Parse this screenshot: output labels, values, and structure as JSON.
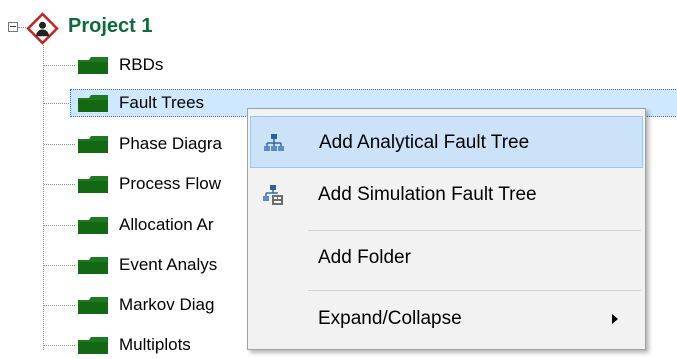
{
  "tree": {
    "project": {
      "label": "Project 1",
      "expander_state": "expanded",
      "icon": "project-diamond-icon"
    },
    "items": [
      {
        "label": "RBDs",
        "icon": "folder-icon"
      },
      {
        "label": "Fault Trees",
        "icon": "folder-icon",
        "selected": true
      },
      {
        "label": "Phase Diagra",
        "icon": "folder-icon"
      },
      {
        "label": "Process Flow",
        "icon": "folder-icon"
      },
      {
        "label": "Allocation Ar",
        "icon": "folder-icon"
      },
      {
        "label": "Event Analys",
        "icon": "folder-icon"
      },
      {
        "label": "Markov Diag",
        "icon": "folder-icon"
      },
      {
        "label": "Multiplots",
        "icon": "folder-icon"
      }
    ]
  },
  "context_menu": {
    "items": [
      {
        "label": "Add Analytical Fault Tree",
        "icon": "analytical-fault-tree-icon",
        "highlighted": true
      },
      {
        "label": "Add Simulation Fault Tree",
        "icon": "simulation-fault-tree-icon"
      },
      {
        "label": "Add Folder"
      },
      {
        "label": "Expand/Collapse",
        "submenu_icon": "submenu-arrow-icon"
      }
    ]
  },
  "colors": {
    "project_label": "#0f6b3b",
    "selection": "#cde8ff",
    "menu_highlight": "#cbe2f8",
    "folder": "#1f7a1f"
  }
}
